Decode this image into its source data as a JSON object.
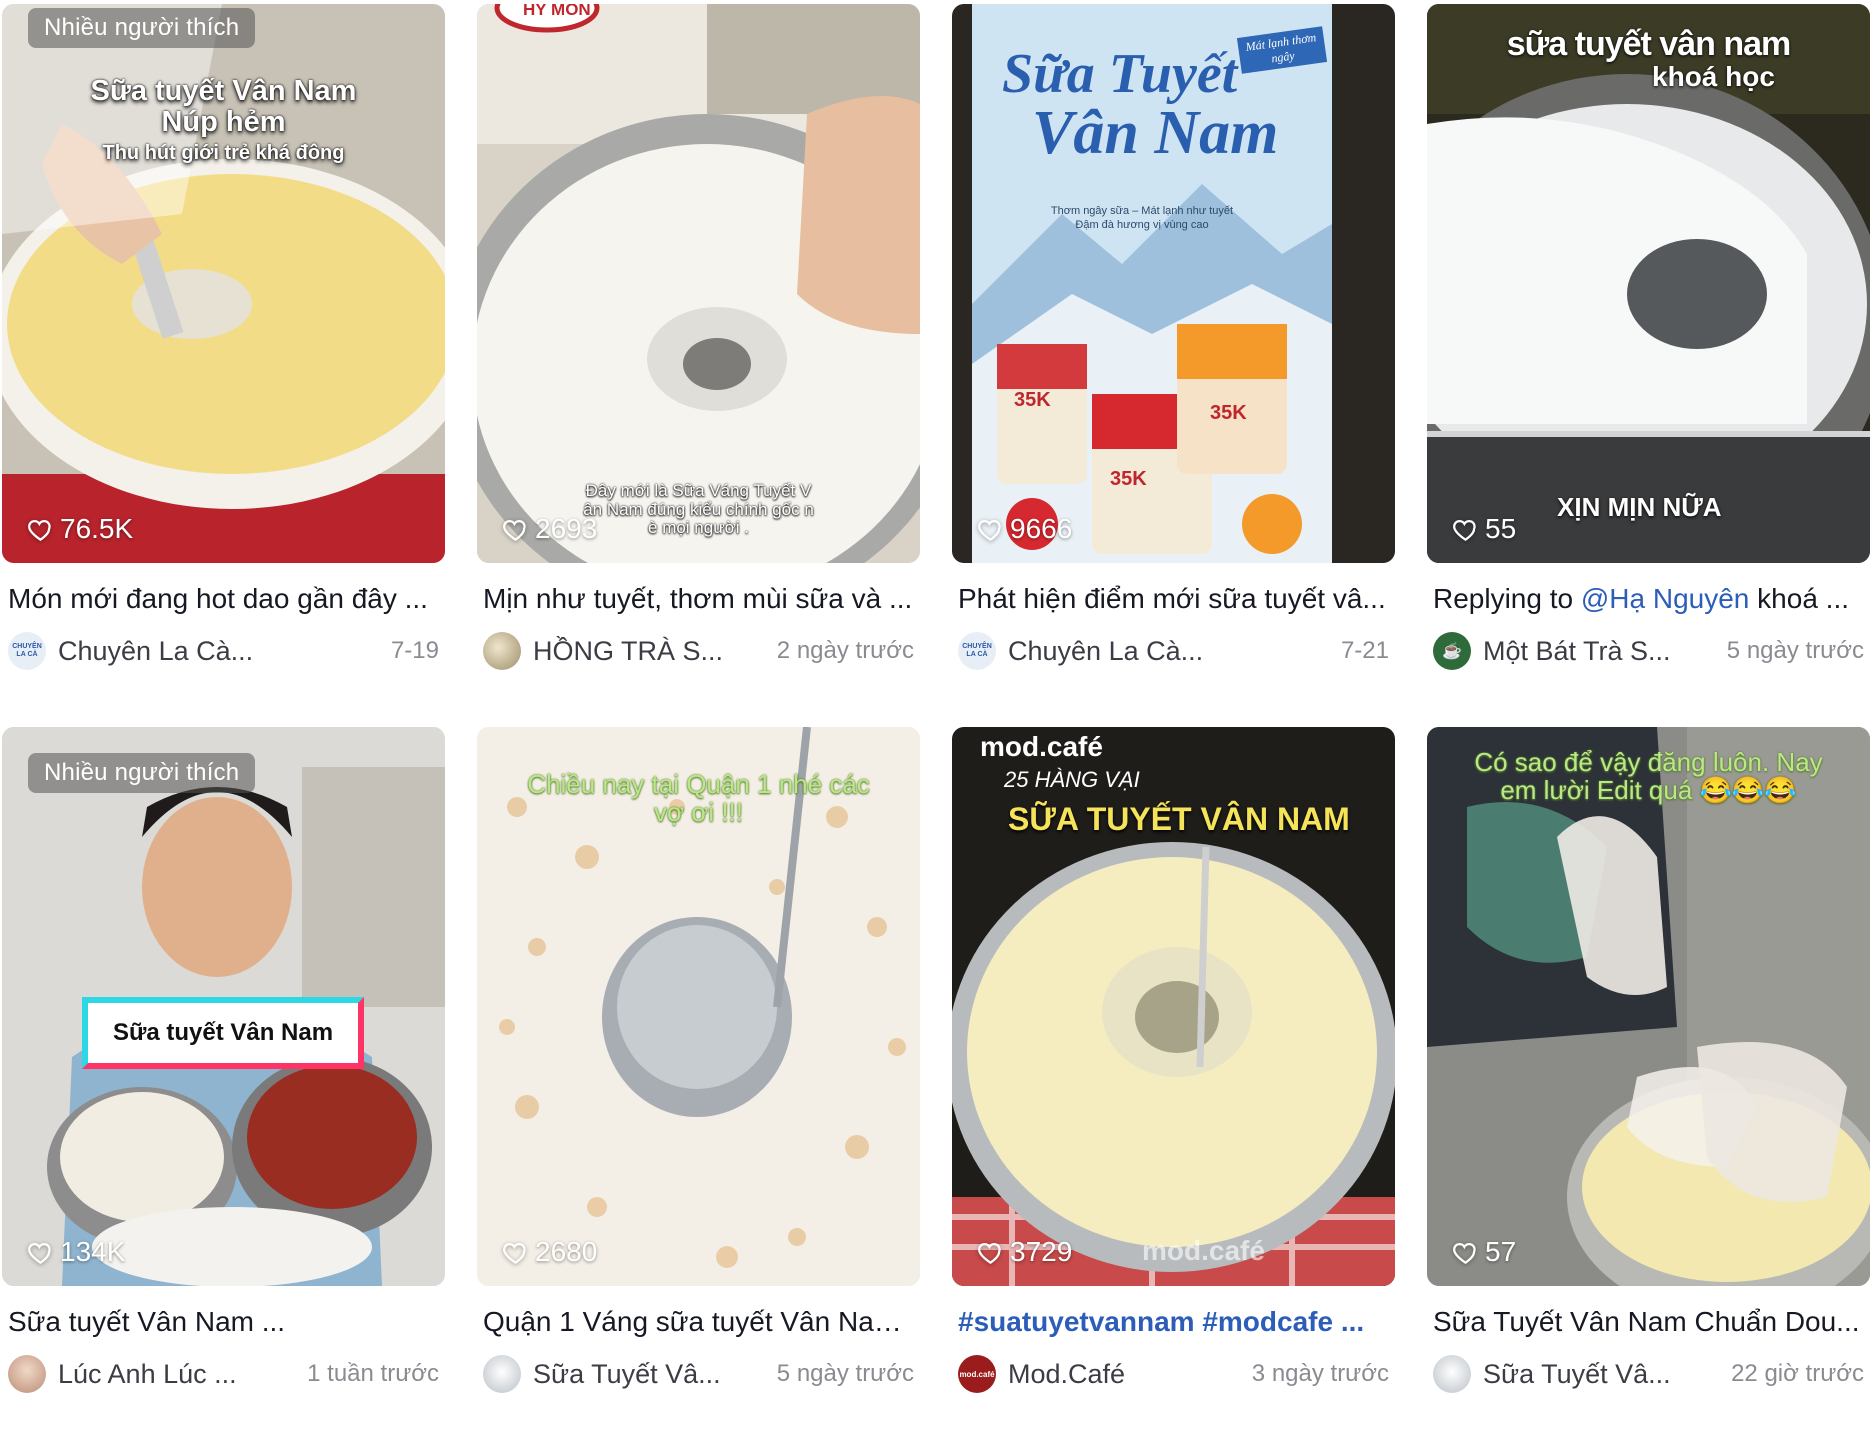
{
  "videos": [
    {
      "badge": "Nhiều người thích",
      "overlay_lines": [
        "Sữa tuyết Vân Nam",
        "Núp hẻm",
        "Thu hút giới trẻ khá đông"
      ],
      "likes": "76.5K",
      "caption": "Món mới đang hot dao gần đây ...",
      "author": "Chuyên La Cà...",
      "date": "7-19",
      "avatar_text": "CHUYÊN LA CÀ"
    },
    {
      "logo_text": "HY MON",
      "overlay_lines": [
        "Đây mới là Sữa Váng Tuyết V",
        "ân Nam đúng kiểu chính gốc n",
        "è mọi người ."
      ],
      "likes": "2693",
      "caption": "Mịn như tuyết, thơm mùi sữa và ...",
      "author": "HỒNG TRÀ S...",
      "date": "2 ngày trước"
    },
    {
      "poster_title_1": "Sữa Tuyết",
      "poster_title_2": "Vân Nam",
      "poster_tag": "Mát lạnh thơm ngây",
      "poster_sub_1": "Thơm ngây sữa – Mát lạnh như tuyết",
      "poster_sub_2": "Đậm đà hương vị vùng cao",
      "price_1": "35K",
      "price_2": "35K",
      "price_3": "35K",
      "likes": "9666",
      "caption": "Phát hiện điểm mới sữa tuyết vâ...",
      "author": "Chuyên La Cà...",
      "date": "7-21",
      "avatar_text": "CHUYÊN LA CÀ"
    },
    {
      "overlay_lines": [
        "sữa tuyết vân nam",
        "khoá học"
      ],
      "bottom_text": "XỊN MỊN NỮA",
      "likes": "55",
      "caption_prefix": "Replying to ",
      "caption_mention": "@Hạ Nguyên",
      "caption_suffix": " khoá ...",
      "author": "Một Bát Trà S...",
      "date": "5 ngày trước"
    },
    {
      "badge": "Nhiều người thích",
      "label_box": "Sữa tuyết Vân Nam",
      "likes": "134K",
      "caption": "Sữa tuyết Vân Nam ...",
      "author": "Lúc Anh Lúc ...",
      "date": "1 tuần trước"
    },
    {
      "overlay_lines": [
        "Chiều nay tại Quận 1 nhé các",
        "vợ ơi !!!"
      ],
      "likes": "2680",
      "caption": "Quận 1 Váng sữa tuyết Vân Nam...",
      "author": "Sữa Tuyết Vâ...",
      "date": "5 ngày trước"
    },
    {
      "brand": "mod.café",
      "subtitle": "25 HÀNG VẠI",
      "title": "SỮA TUYẾT VÂN NAM",
      "watermark": "mod.café",
      "likes": "3729",
      "caption": "#suatuyetvannam #modcafe ...",
      "author": "Mod.Café",
      "date": "3 ngày trước",
      "avatar_text": "mod.café"
    },
    {
      "overlay_lines": [
        "Có sao để vậy đăng luôn. Nay",
        "em lười Edit quá 😂😂😂"
      ],
      "likes": "57",
      "caption": "Sữa Tuyết Vân Nam Chuẩn Dou...",
      "author": "Sữa Tuyết Vâ...",
      "date": "22 giờ trước"
    }
  ],
  "colors": {
    "text": "#161823",
    "muted": "#8a8b91",
    "link": "#2b5db9",
    "overlay_yellow": "#f5e45a",
    "overlay_green": "#b8e986"
  }
}
